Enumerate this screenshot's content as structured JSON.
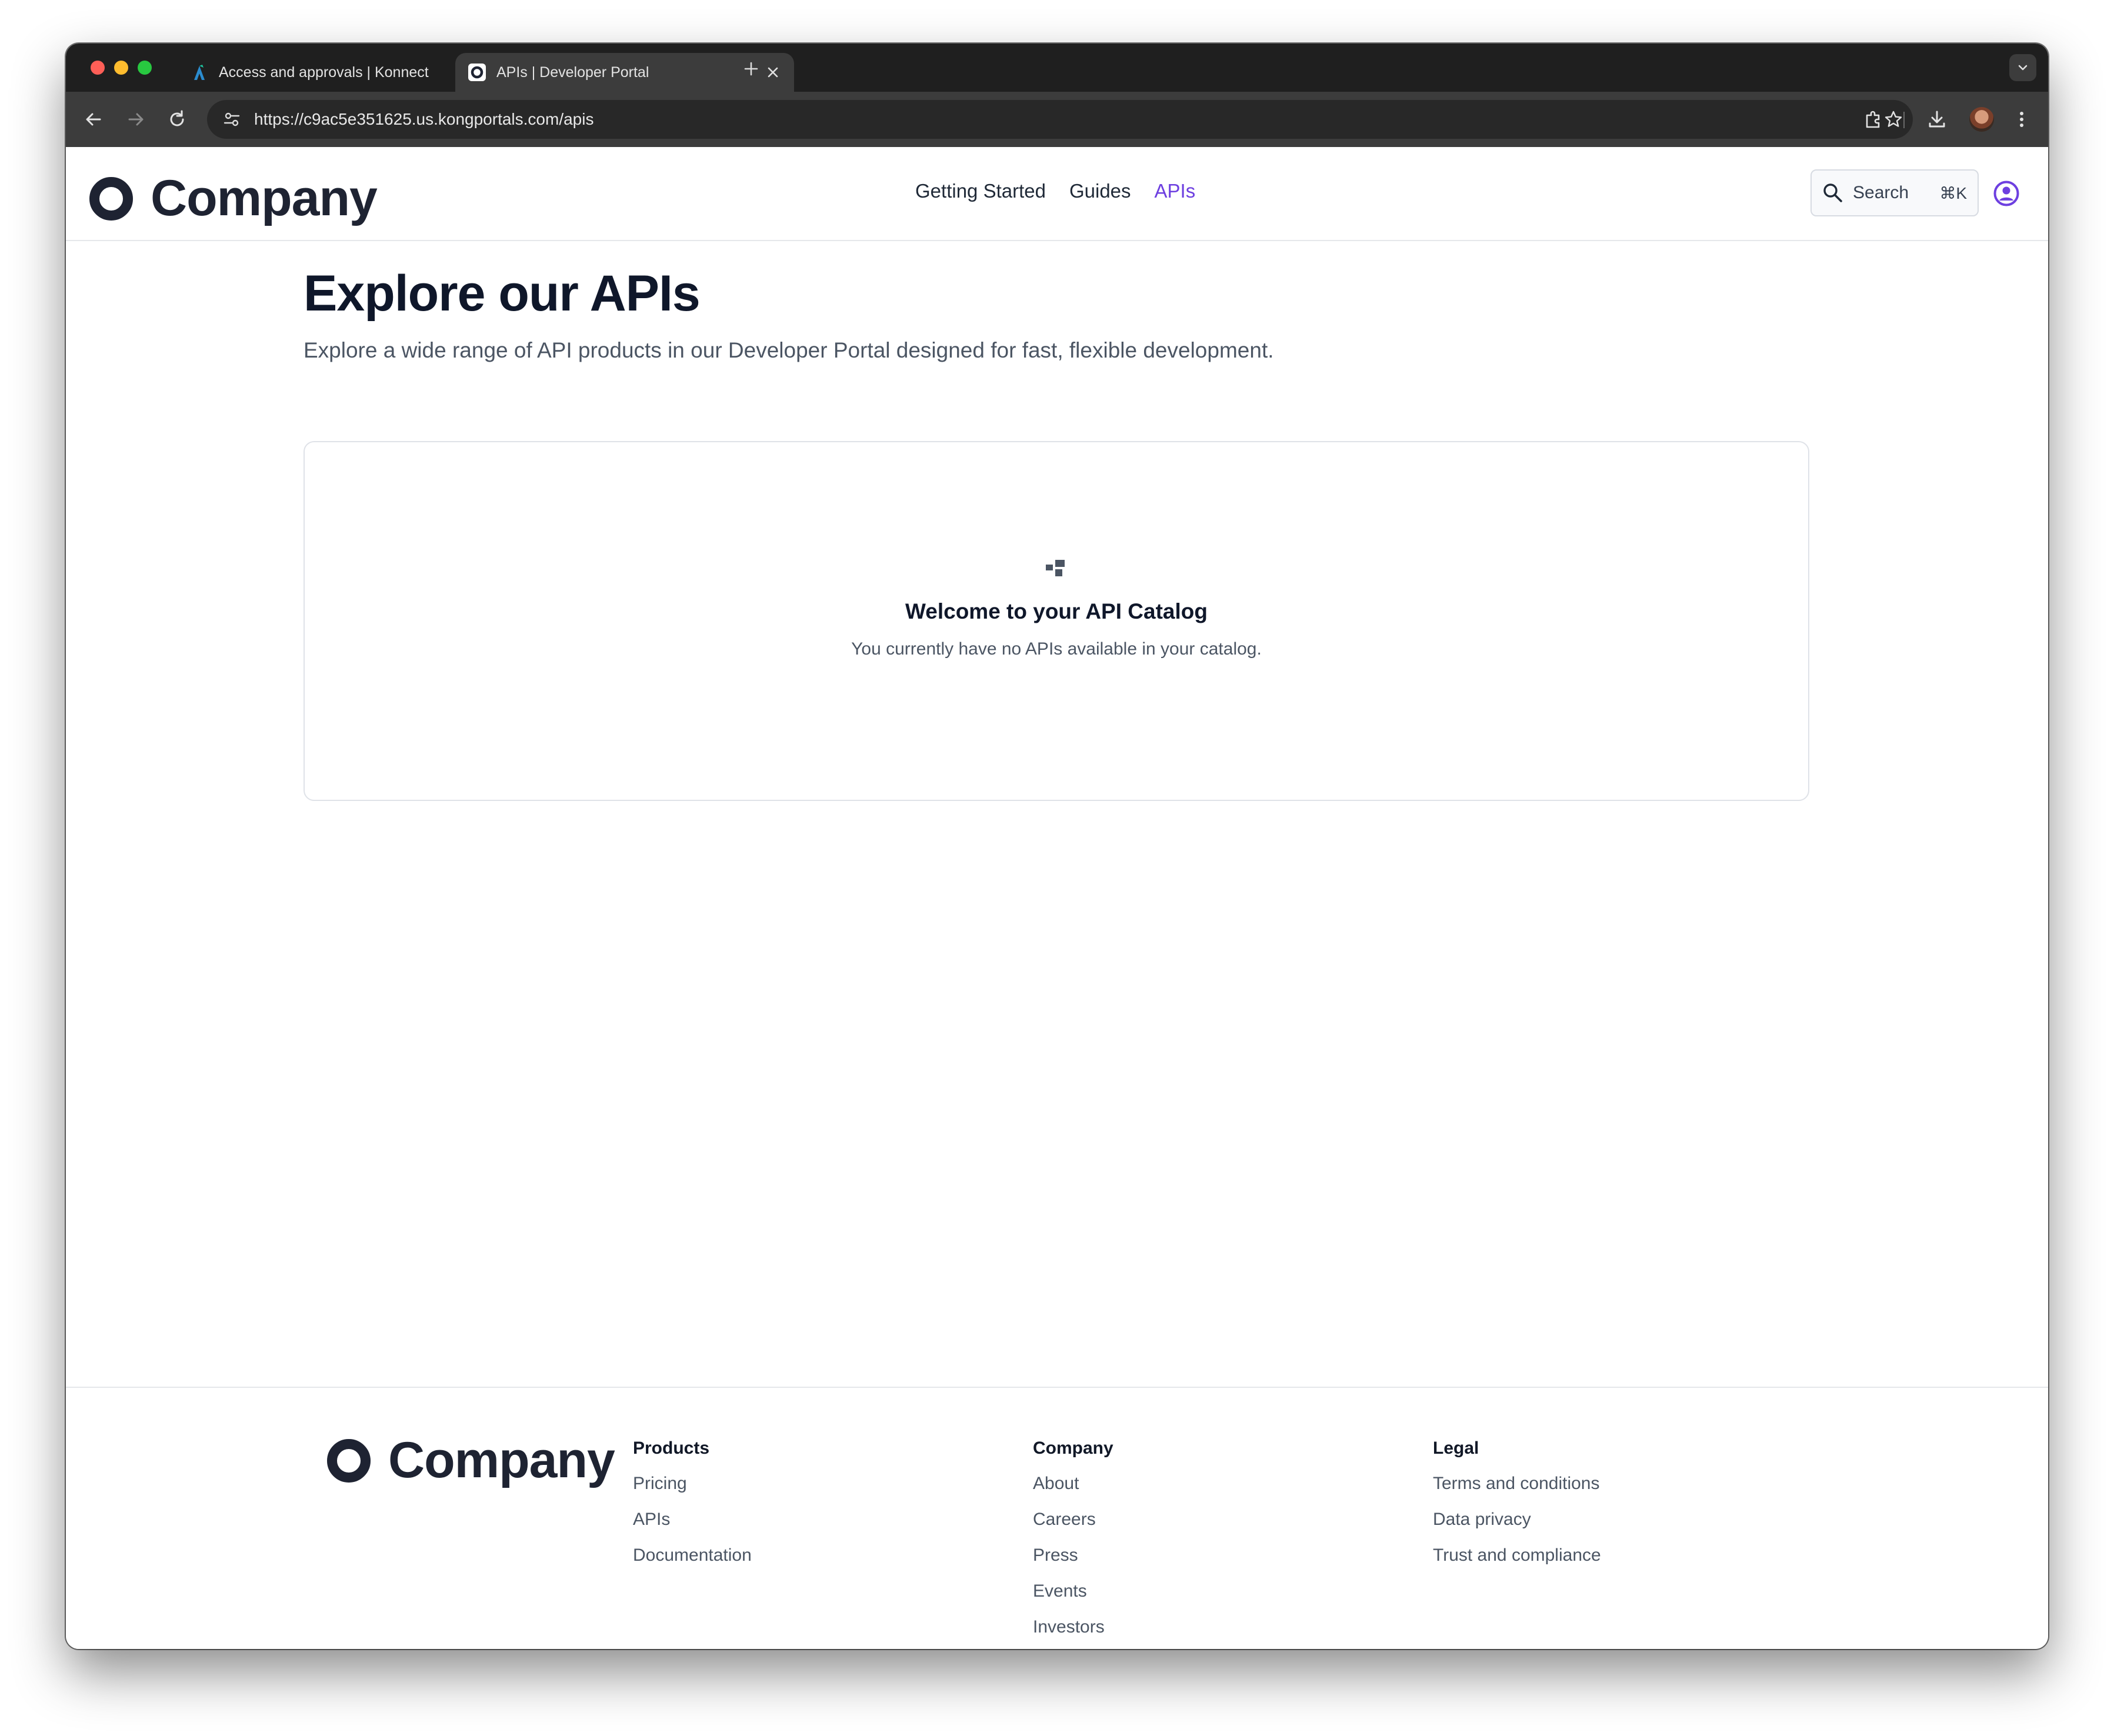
{
  "browser": {
    "tabs": [
      {
        "title": "Access and approvals | Konnect",
        "active": false
      },
      {
        "title": "APIs | Developer Portal",
        "active": true
      }
    ],
    "url": "https://c9ac5e351625.us.kongportals.com/apis"
  },
  "header": {
    "logo_text": "Company",
    "nav": [
      {
        "label": "Getting Started",
        "active": false
      },
      {
        "label": "Guides",
        "active": false
      },
      {
        "label": "APIs",
        "active": true
      }
    ],
    "search_label": "Search",
    "search_shortcut": "⌘K"
  },
  "main": {
    "title": "Explore our APIs",
    "subtitle": "Explore a wide range of API products in our Developer Portal designed for fast, flexible development.",
    "empty_state": {
      "title": "Welcome to your API Catalog",
      "message": "You currently have no APIs available in your catalog."
    }
  },
  "footer": {
    "logo_text": "Company",
    "columns": [
      {
        "heading": "Products",
        "links": [
          "Pricing",
          "APIs",
          "Documentation"
        ]
      },
      {
        "heading": "Company",
        "links": [
          "About",
          "Careers",
          "Press",
          "Events",
          "Investors"
        ]
      },
      {
        "heading": "Legal",
        "links": [
          "Terms and conditions",
          "Data privacy",
          "Trust and compliance"
        ]
      }
    ]
  },
  "colors": {
    "accent": "#6d3fe0",
    "text_dark": "#0f172a",
    "text_muted": "#4b5563"
  }
}
